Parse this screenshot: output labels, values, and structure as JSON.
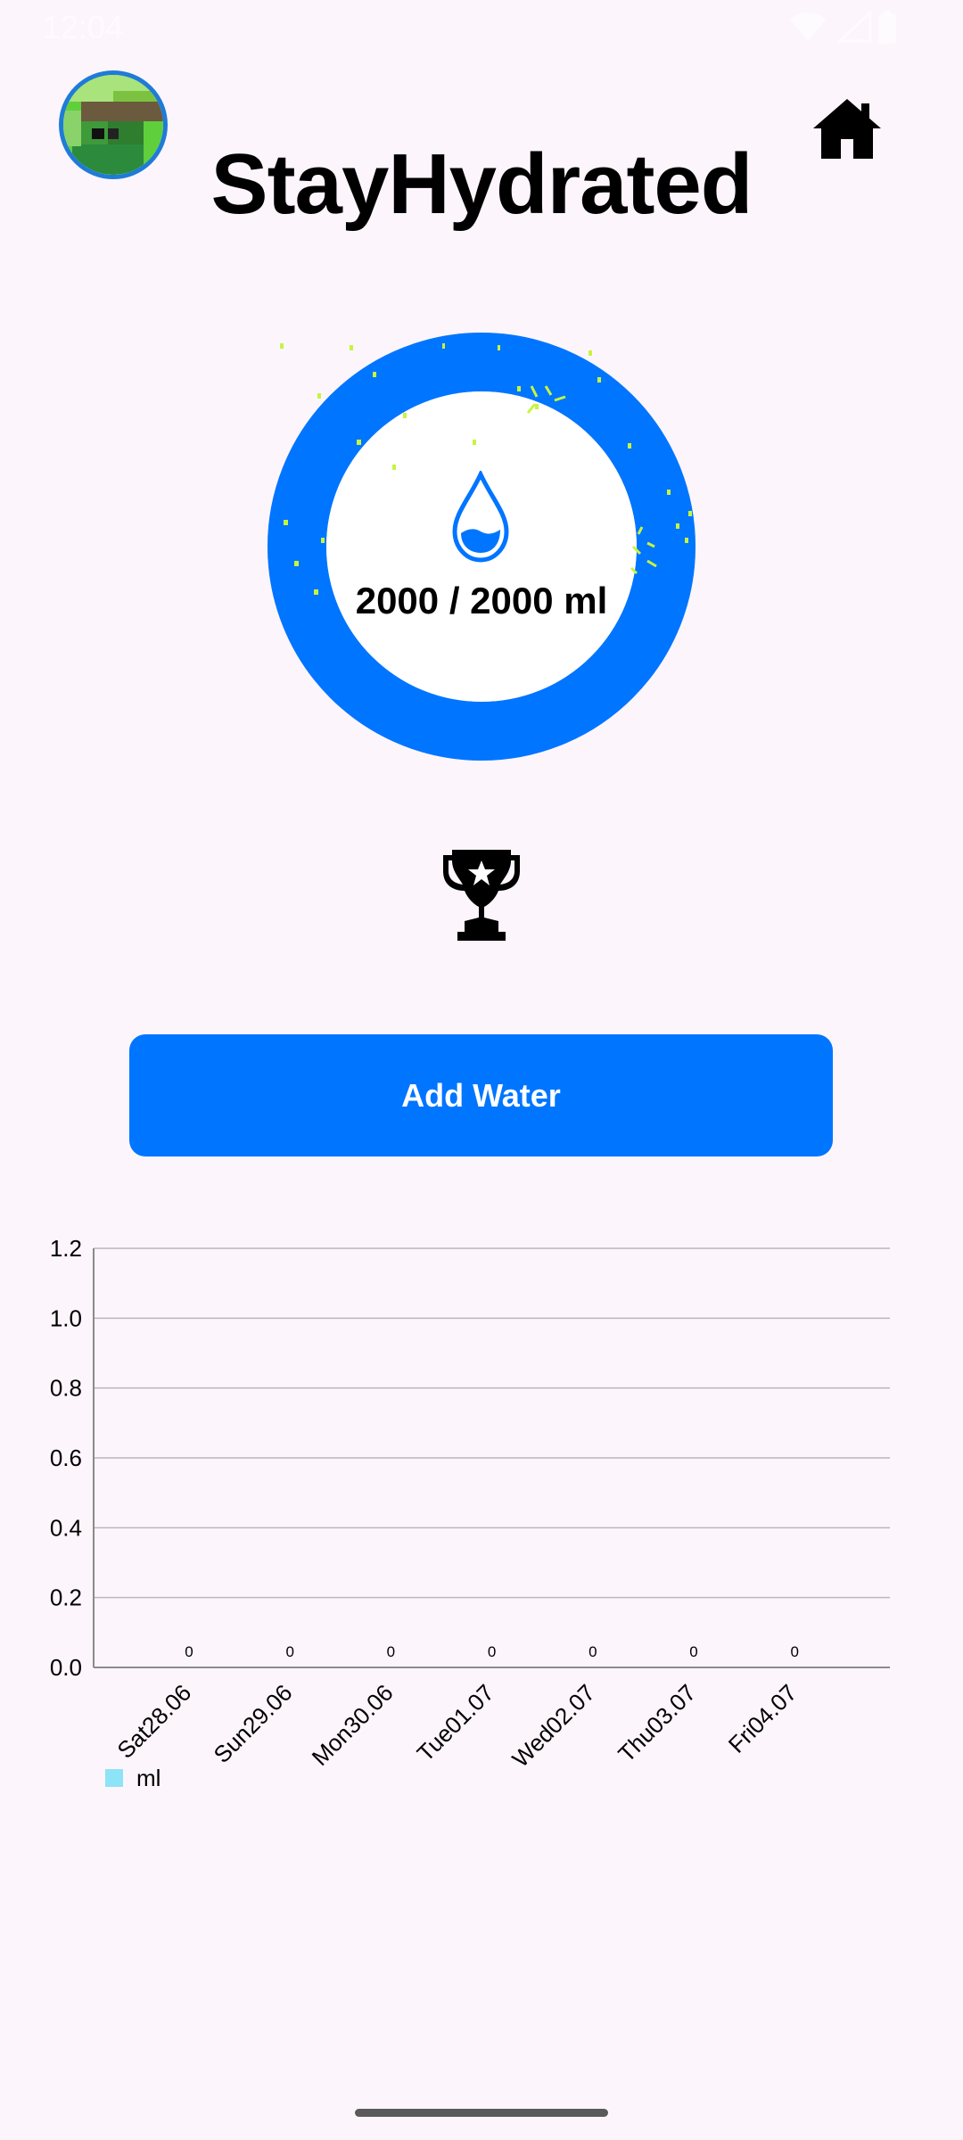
{
  "status_bar": {
    "time": "12:04"
  },
  "header": {
    "title": "StayHydrated",
    "avatar": "pixel-avatar",
    "home_icon": "home-icon"
  },
  "progress": {
    "text": "2000 / 2000 ml",
    "current": 2000,
    "goal": 2000,
    "fraction": 1.0,
    "ring_color": "#0075ff"
  },
  "trophy_icon": "trophy-icon",
  "add_button": {
    "label": "Add Water",
    "color": "#0075ff"
  },
  "chart_data": {
    "type": "bar",
    "categories": [
      "Sat28.06",
      "Sun29.06",
      "Mon30.06",
      "Tue01.07",
      "Wed02.07",
      "Thu03.07",
      "Fri04.07"
    ],
    "series": [
      {
        "name": "ml",
        "values": [
          0,
          0,
          0,
          0,
          0,
          0,
          0
        ],
        "color": "#8de4f6"
      }
    ],
    "yticks": [
      "0.0",
      "0.2",
      "0.4",
      "0.6",
      "0.8",
      "1.0",
      "1.2"
    ],
    "ylim": [
      0,
      1.2
    ],
    "grid": true,
    "legend_placement": "bottom-left"
  },
  "legend": {
    "label": "ml"
  }
}
